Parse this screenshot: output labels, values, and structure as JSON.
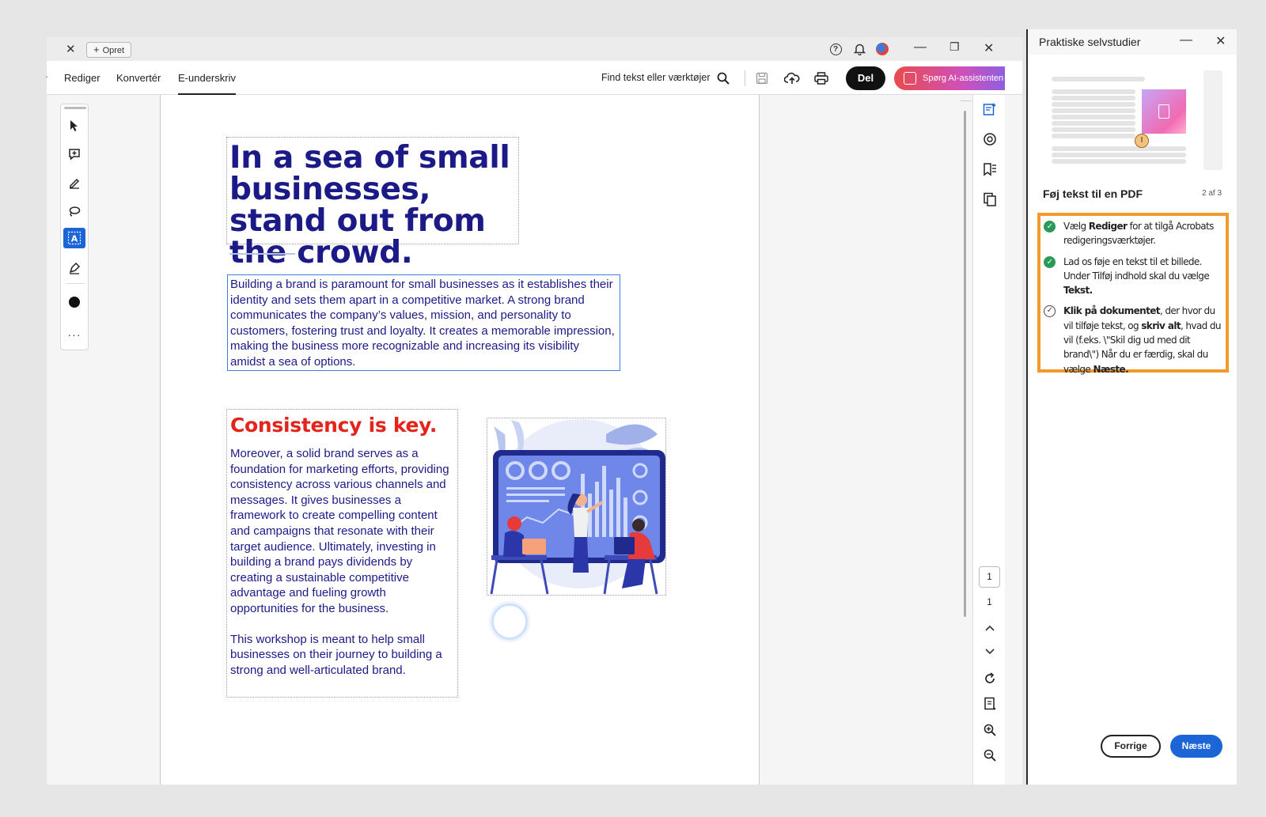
{
  "window": {
    "create_label": "Opret",
    "tab_close": "✕"
  },
  "toolbar": {
    "menu": [
      "Rediger",
      "Konvertér",
      "E-underskriv"
    ],
    "active_menu": "E-underskriv",
    "find_label": "Find tekst eller værktøjer",
    "share_label": "Del",
    "ai_label": "Spørg AI-assistenten"
  },
  "document": {
    "headline": "In a sea of small businesses, stand out from the crowd.",
    "intro": "Building a brand is paramount for small businesses as it establishes their identity and sets them apart in a competitive market. A strong brand communicates the company’s values, mission, and personality to customers, fostering trust and loyalty. It creates a memorable impression, making the business more recognizable and increasing its visibility amidst a sea of options.",
    "section_title": "Consistency is key.",
    "section_p1": "Moreover, a solid brand serves as a foundation for marketing efforts, providing consistency across various channels and messages. It gives businesses a framework to create compelling content and campaigns that resonate with their target audience. Ultimately, investing in building a brand pays dividends by creating a sustainable competitive advantage and fueling growth opportunities for the business.",
    "section_p2": "This workshop is meant to help small businesses on their journey to building a strong and well-articulated brand.",
    "image_alt": "Team analyzing charts illustration"
  },
  "pagination": {
    "current": "1",
    "total": "1"
  },
  "tutorial": {
    "title": "Praktiske selvstudier",
    "step_title": "Føj tekst til en PDF",
    "step_count": "2 af 3",
    "steps": [
      {
        "done": true,
        "parts": [
          "Vælg ",
          "Rediger",
          " for at tilgå Acrobats redigeringsværktøjer."
        ]
      },
      {
        "done": true,
        "parts": [
          "Lad os føje en tekst til et billede. Under Tilføj indhold skal du vælge ",
          "Tekst.",
          ""
        ]
      },
      {
        "done": false,
        "text_html": "<b>Klik på dokumentet</b>, der hvor du vil tilføje tekst, og <b>skriv alt</b>, hvad du vil (f.eks. \\\"Skil dig ud med dit brand\\\") Når du er færdig, skal du vælge <b>Næste.</b>"
      }
    ],
    "prev_label": "Forrige",
    "next_label": "Næste"
  },
  "colors": {
    "accent": "#1b65d6",
    "heading_navy": "#1c1a87",
    "heading_red": "#e4231b",
    "highlight_orange": "#f29a2c",
    "done_green": "#2a9a5a"
  }
}
